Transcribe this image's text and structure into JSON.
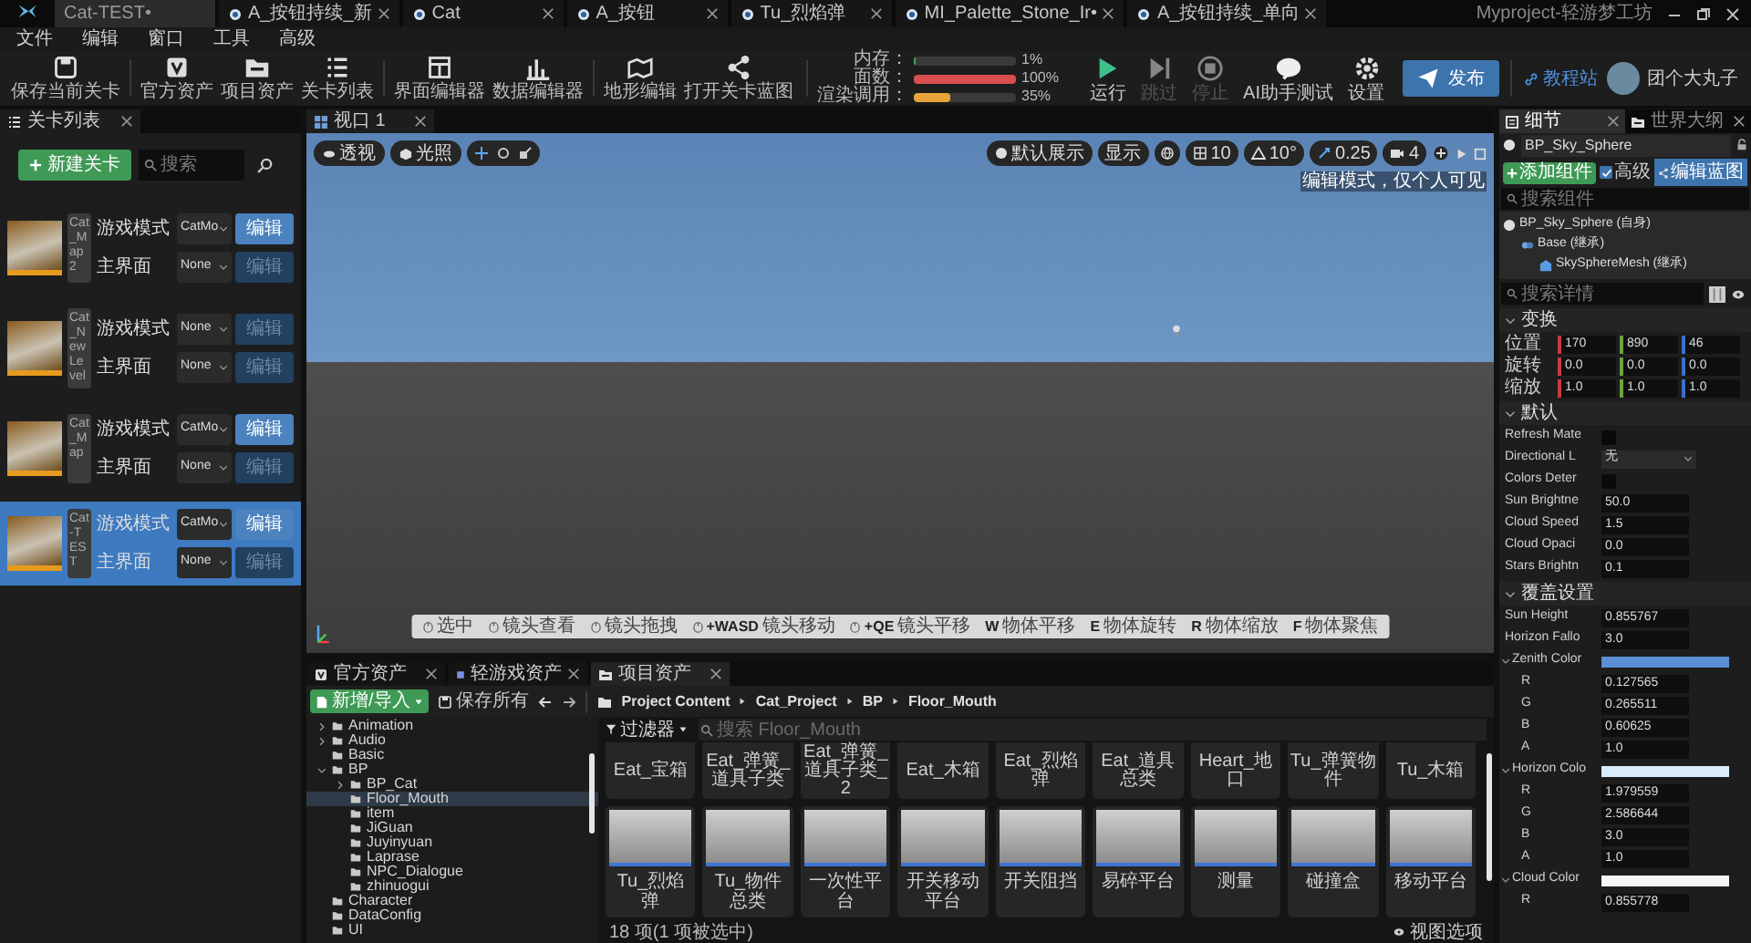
{
  "title_bar": {
    "tabs": [
      {
        "label": "Cat-TEST•",
        "selected": true
      },
      {
        "label": "A_按钮持续_新",
        "selected": false
      },
      {
        "label": "Cat",
        "selected": false
      },
      {
        "label": "A_按钮",
        "selected": false
      },
      {
        "label": "Tu_烈焰弹",
        "selected": false
      },
      {
        "label": "MI_Palette_Stone_Ir•",
        "selected": false
      },
      {
        "label": "A_按钮持续_单向",
        "selected": false
      }
    ],
    "app_title": "Myproject-轻游梦工坊"
  },
  "menu": [
    "文件",
    "编辑",
    "窗口",
    "工具",
    "高级"
  ],
  "toolbar": {
    "groups": [
      [
        {
          "label": "保存当前关卡"
        }
      ],
      [
        {
          "label": "官方资产"
        },
        {
          "label": "项目资产"
        },
        {
          "label": "关卡列表"
        }
      ],
      [
        {
          "label": "界面编辑器"
        },
        {
          "label": "数据编辑器"
        }
      ],
      [
        {
          "label": "地形编辑"
        },
        {
          "label": "打开关卡蓝图"
        }
      ]
    ],
    "stats": [
      {
        "label": "内存：",
        "level": 0.01,
        "reading": "1%",
        "color": "#3fae5a"
      },
      {
        "label": "面数：",
        "level": 1.0,
        "reading": "100%",
        "color": "#d94f4f"
      },
      {
        "label": "渲染调用：",
        "level": 0.35,
        "reading": "35%",
        "color": "#e8a33a"
      }
    ],
    "play": [
      {
        "label": "运行",
        "disabled": false
      },
      {
        "label": "跳过",
        "disabled": true
      },
      {
        "label": "停止",
        "disabled": true
      },
      {
        "label": "AI助手测试",
        "disabled": false
      },
      {
        "label": "设置",
        "disabled": false
      }
    ],
    "publish": "发布",
    "tutorial": "教程站",
    "user": "团个大丸子"
  },
  "level_list": {
    "tab": "关卡列表",
    "new_button": "新建关卡",
    "search_placeholder": "搜索",
    "levels": [
      {
        "name": "Cat_Map2",
        "selected": false,
        "fields": [
          {
            "label": "游戏模式",
            "value": "CatMo",
            "button": "编辑",
            "enabled": true
          },
          {
            "label": "主界面",
            "value": "None",
            "button": "编辑",
            "enabled": false
          }
        ]
      },
      {
        "name": "Cat_NewLevel",
        "selected": false,
        "fields": [
          {
            "label": "游戏模式",
            "value": "None",
            "button": "编辑",
            "enabled": false
          },
          {
            "label": "主界面",
            "value": "None",
            "button": "编辑",
            "enabled": false
          }
        ]
      },
      {
        "name": "Cat_Map",
        "selected": false,
        "fields": [
          {
            "label": "游戏模式",
            "value": "CatMo",
            "button": "编辑",
            "enabled": true
          },
          {
            "label": "主界面",
            "value": "None",
            "button": "编辑",
            "enabled": false
          }
        ]
      },
      {
        "name": "Cat-TEST",
        "selected": true,
        "fields": [
          {
            "label": "游戏模式",
            "value": "CatMo",
            "button": "编辑",
            "enabled": true
          },
          {
            "label": "主界面",
            "value": "None",
            "button": "编辑",
            "enabled": false
          }
        ]
      }
    ]
  },
  "viewport": {
    "tab": "视口 1",
    "left_controls": [
      "透视",
      "光照"
    ],
    "right_controls": [
      "默认展示",
      "显示",
      "10",
      "10°",
      "0.25",
      "4"
    ],
    "mode_label": "编辑模式，仅个人可见",
    "hints": [
      {
        "kind": "mouse",
        "label": "选中"
      },
      {
        "kind": "mouse",
        "label": "镜头查看"
      },
      {
        "kind": "mouse",
        "label": "镜头拖拽"
      },
      {
        "kind": "mouse",
        "key": "+WASD",
        "label": "镜头移动"
      },
      {
        "kind": "mouse",
        "key": "+QE",
        "label": "镜头平移"
      },
      {
        "kind": "key",
        "key": "W",
        "label": "物体平移"
      },
      {
        "kind": "key",
        "key": "E",
        "label": "物体旋转"
      },
      {
        "kind": "key",
        "key": "R",
        "label": "物体缩放"
      },
      {
        "kind": "key",
        "key": "F",
        "label": "物体聚焦"
      }
    ]
  },
  "content_browser": {
    "tabs": [
      {
        "label": "官方资产",
        "selected": false
      },
      {
        "label": "轻游戏资产",
        "selected": false
      },
      {
        "label": "项目资产",
        "selected": true
      }
    ],
    "add_button": "新增/导入",
    "save_all": "保存所有",
    "breadcrumb": [
      "Project Content",
      "Cat_Project",
      "BP",
      "Floor_Mouth"
    ],
    "folders": [
      {
        "label": "Animation",
        "expanded": false,
        "selected": false
      },
      {
        "label": "Audio",
        "expanded": false,
        "selected": false
      },
      {
        "label": "Basic",
        "selected": false
      },
      {
        "label": "BP",
        "expanded": true,
        "selected": false,
        "children": [
          {
            "label": "BP_Cat",
            "expanded": false,
            "selected": false
          },
          {
            "label": "Floor_Mouth",
            "selected": true
          },
          {
            "label": "item",
            "selected": false
          },
          {
            "label": "JiGuan",
            "selected": false
          },
          {
            "label": "Juyinyuan",
            "selected": false
          },
          {
            "label": "Laprase",
            "selected": false
          },
          {
            "label": "NPC_Dialogue",
            "selected": false
          },
          {
            "label": "zhinuogui",
            "selected": false
          }
        ]
      },
      {
        "label": "Character",
        "selected": false
      },
      {
        "label": "DataConfig",
        "selected": false
      },
      {
        "label": "UI",
        "selected": false
      }
    ],
    "filter": "过滤器",
    "search_placeholder": "搜索 Floor_Mouth",
    "assets_cut_row": [
      "Eat_宝箱",
      "Eat_弹簧_道具子类",
      "Eat_弹簧_道具子类_2",
      "Eat_木箱",
      "Eat_烈焰弹",
      "Eat_道具总类",
      "Heart_地口",
      "Tu_弹簧物件",
      "Tu_木箱"
    ],
    "assets": [
      "Tu_烈焰弹",
      "Tu_物件总类",
      "一次性平台",
      "开关移动平台",
      "开关阻挡",
      "易碎平台",
      "测量",
      "碰撞盒",
      "移动平台"
    ],
    "status": "18 项(1 项被选中)",
    "view_options": "视图选项"
  },
  "details": {
    "tabs": [
      {
        "label": "细节",
        "selected": true
      },
      {
        "label": "世界大纲",
        "selected": false
      }
    ],
    "object": "BP_Sky_Sphere",
    "add_component": "添加组件",
    "advanced": {
      "label": "高级",
      "checked": true
    },
    "edit_blueprint": "编辑蓝图",
    "component_search_placeholder": "搜索组件",
    "components": [
      {
        "label": "BP_Sky_Sphere",
        "note": "(自身)",
        "children": [
          {
            "label": "Base (继承)",
            "children": [
              {
                "label": "SkySphereMesh (继承)"
              }
            ]
          }
        ]
      }
    ],
    "detail_search_placeholder": "搜索详情",
    "sections": [
      {
        "title": "变换",
        "expanded": true,
        "rows": [
          {
            "kind": "vector",
            "label": "位置",
            "values": [
              "170",
              "890",
              "46"
            ]
          },
          {
            "kind": "vector",
            "label": "旋转",
            "values": [
              "0.0",
              "0.0",
              "0.0"
            ]
          },
          {
            "kind": "vector",
            "label": "缩放",
            "values": [
              "1.0",
              "1.0",
              "1.0"
            ]
          }
        ]
      },
      {
        "title": "默认",
        "expanded": true,
        "rows": [
          {
            "kind": "checkbox",
            "label": "Refresh Mate",
            "checked": false
          },
          {
            "kind": "dropdown",
            "label": "Directional L",
            "value": "无"
          },
          {
            "kind": "checkbox",
            "label": "Colors Deter",
            "checked": false
          },
          {
            "kind": "number",
            "label": "Sun Brightne",
            "value": "50.0"
          },
          {
            "kind": "number",
            "label": "Cloud Speed",
            "value": "1.5"
          },
          {
            "kind": "number",
            "label": "Cloud Opaci",
            "value": "0.0"
          },
          {
            "kind": "number",
            "label": "Stars Brightn",
            "value": "0.1"
          }
        ]
      },
      {
        "title": "覆盖设置",
        "expanded": true,
        "rows": [
          {
            "kind": "number",
            "label": "Sun Height",
            "value": "0.855767"
          },
          {
            "kind": "number",
            "label": "Horizon Fallo",
            "value": "3.0"
          },
          {
            "kind": "color",
            "label": "Zenith Color",
            "color": "#5b8fd6"
          },
          {
            "kind": "channel",
            "label": "R",
            "value": "0.127565"
          },
          {
            "kind": "channel",
            "label": "G",
            "value": "0.265511"
          },
          {
            "kind": "channel",
            "label": "B",
            "value": "0.60625"
          },
          {
            "kind": "channel",
            "label": "A",
            "value": "1.0"
          },
          {
            "kind": "color",
            "label": "Horizon Colo",
            "color": "#d8ecfb"
          },
          {
            "kind": "channel",
            "label": "R",
            "value": "1.979559"
          },
          {
            "kind": "channel",
            "label": "G",
            "value": "2.586644"
          },
          {
            "kind": "channel",
            "label": "B",
            "value": "3.0"
          },
          {
            "kind": "channel",
            "label": "A",
            "value": "1.0"
          },
          {
            "kind": "color",
            "label": "Cloud Color",
            "color": "#f4f6f8"
          },
          {
            "kind": "channel",
            "label": "R",
            "value": "0.855778"
          }
        ]
      }
    ]
  }
}
